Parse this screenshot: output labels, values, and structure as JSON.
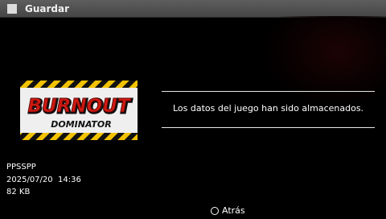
{
  "titlebar": {
    "title": "Guardar",
    "icon": "square-icon"
  },
  "thumbnail": {
    "logo_line1": "BURNOUT",
    "logo_line2": "DOMINATOR"
  },
  "message": {
    "text": "Los datos del juego han sido almacenados."
  },
  "save_info": {
    "app": "PPSSPP",
    "datetime": "2025/07/20  14:36",
    "size": "82 KB"
  },
  "footer": {
    "back_label": "Atrás",
    "back_icon": "circle-button-icon"
  },
  "colors": {
    "titlebar": "#4f4f4f",
    "background": "#000000",
    "logo_red": "#cc1a12",
    "stripe_yellow": "#f2c200"
  }
}
